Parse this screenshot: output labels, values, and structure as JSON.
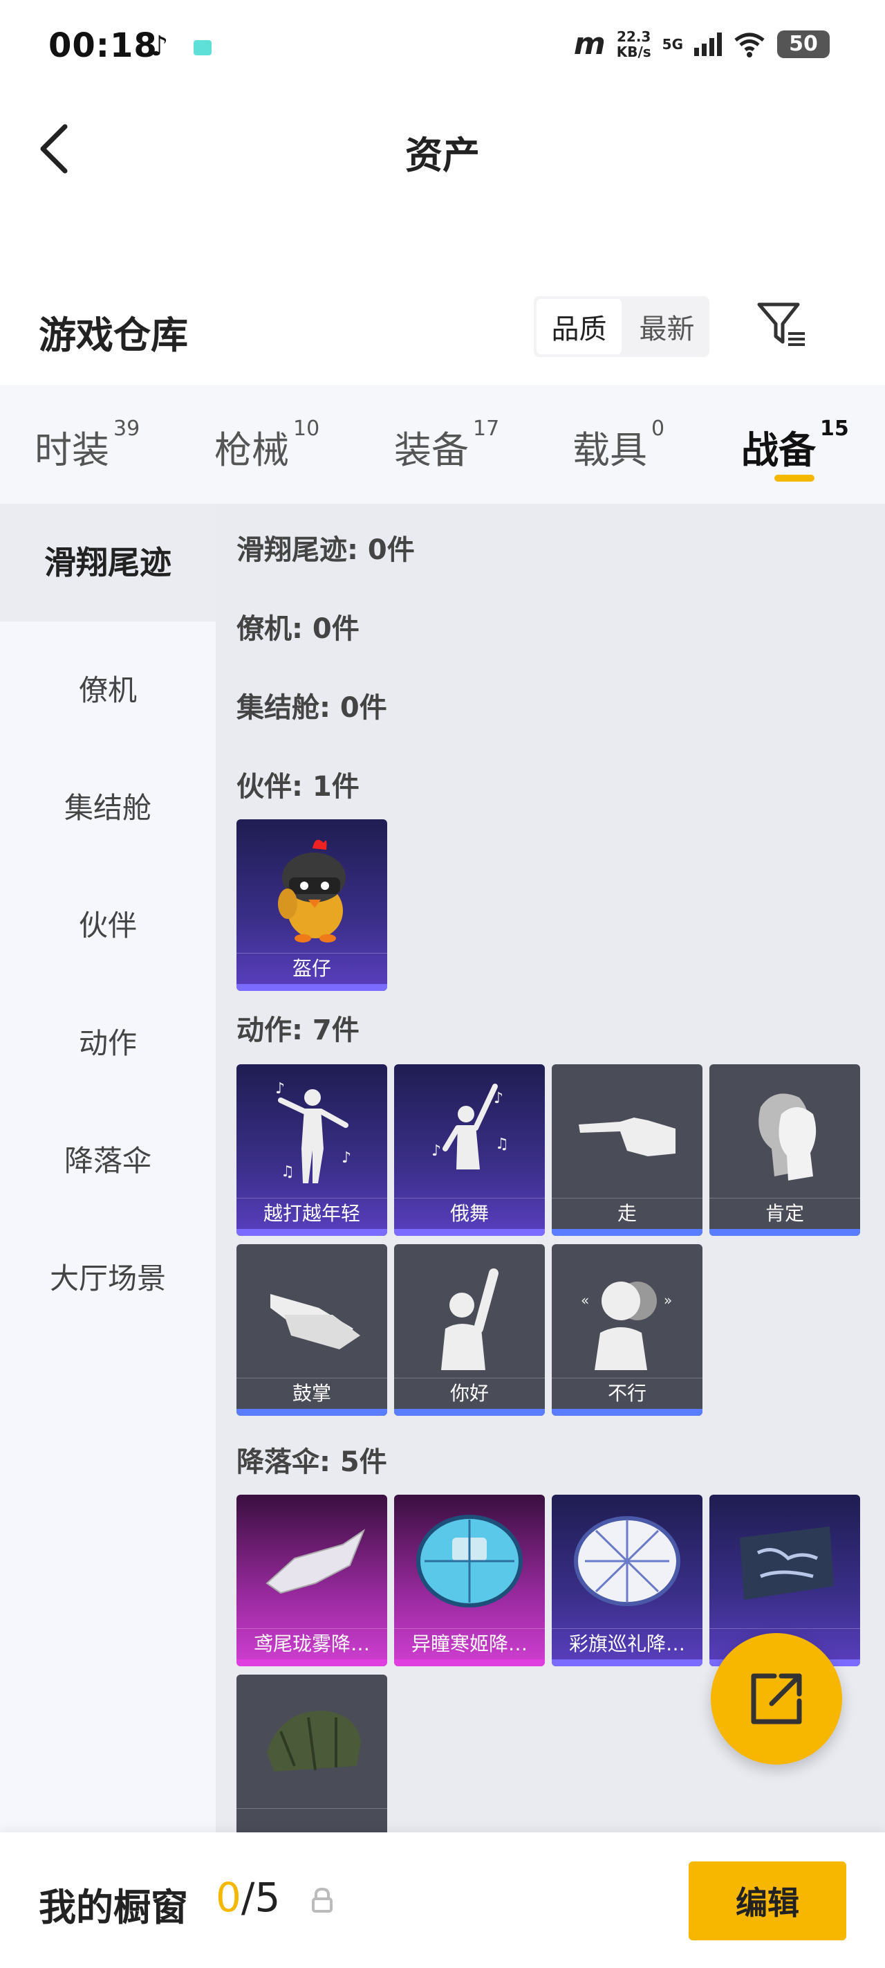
{
  "status_bar": {
    "time": "00:18",
    "speed_value": "22.3",
    "speed_unit": "KB/s",
    "network": "5G",
    "battery": "50"
  },
  "header": {
    "title": "资产"
  },
  "warehouse": {
    "title": "游戏仓库",
    "sort": [
      "品质",
      "最新"
    ]
  },
  "tabs": [
    {
      "label": "时装",
      "count": "39"
    },
    {
      "label": "枪械",
      "count": "10"
    },
    {
      "label": "装备",
      "count": "17"
    },
    {
      "label": "载具",
      "count": "0"
    },
    {
      "label": "战备",
      "count": "15"
    }
  ],
  "sidebar": [
    "滑翔尾迹",
    "僚机",
    "集结舱",
    "伙伴",
    "动作",
    "降落伞",
    "大厅场景"
  ],
  "groups": {
    "glide": "滑翔尾迹: 0件",
    "wingman": "僚机: 0件",
    "capsule": "集结舱: 0件",
    "partner": "伙伴: 1件",
    "emote": "动作: 7件",
    "parachute": "降落伞: 5件"
  },
  "partner_items": [
    "盔仔"
  ],
  "emote_items": [
    "越打越年轻",
    "俄舞",
    "走",
    "肯定",
    "鼓掌",
    "你好",
    "不行"
  ],
  "parachute_items": [
    "鸢尾珑雾降…",
    "异瞳寒姬降…",
    "彩旗巡礼降…",
    "",
    ""
  ],
  "showcase": {
    "label": "我的橱窗",
    "current": "0",
    "total": "/5",
    "edit": "编辑"
  }
}
